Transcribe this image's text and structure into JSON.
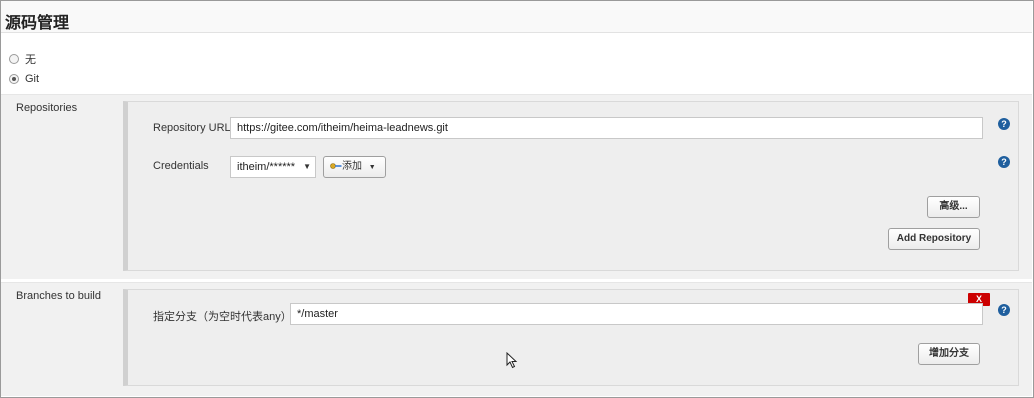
{
  "header": {
    "title": "源码管理"
  },
  "scm_options": [
    {
      "label": "无",
      "selected": false
    },
    {
      "label": "Git",
      "selected": true
    }
  ],
  "repositories": {
    "section_label": "Repositories",
    "url_label": "Repository URL",
    "url_value": "https://gitee.com/itheim/heima-leadnews.git",
    "credentials_label": "Credentials",
    "credentials_value": "itheim/******",
    "add_label": "添加",
    "advanced_label": "高级...",
    "add_repository_label": "Add Repository"
  },
  "branches": {
    "section_label": "Branches to build",
    "branch_label": "指定分支（为空时代表any）",
    "branch_value": "*/master",
    "delete_label": "X",
    "add_branch_label": "增加分支"
  },
  "help_glyph": "?",
  "icons": [
    "question-help-icon",
    "key-icon",
    "caret-down-icon",
    "mouse-cursor-icon",
    "radio-icon"
  ],
  "colors": {
    "help": "#1f5f9e",
    "delete": "#cc0000",
    "panel_bg": "#eeeeee"
  }
}
